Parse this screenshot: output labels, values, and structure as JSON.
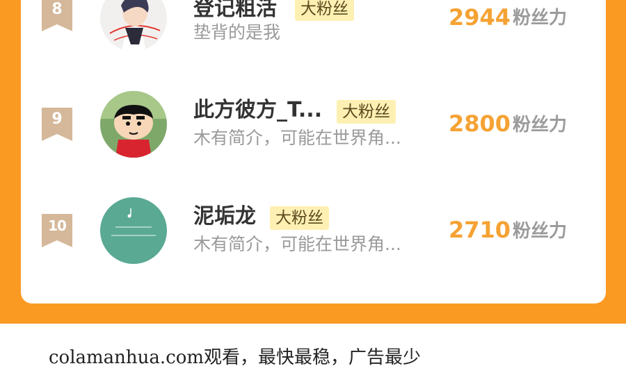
{
  "leaderboard": {
    "rows": [
      {
        "rank": "8",
        "name": "登记粗活",
        "badge": "大粉丝",
        "bio": "垫背的是我",
        "score": "2944",
        "score_label": "粉丝力"
      },
      {
        "rank": "9",
        "name": "此方彼方_T...",
        "badge": "大粉丝",
        "bio": "木有简介，可能在世界角...",
        "score": "2800",
        "score_label": "粉丝力"
      },
      {
        "rank": "10",
        "name": "泥垢龙",
        "badge": "大粉丝",
        "bio": "木有简介，可能在世界角...",
        "score": "2710",
        "score_label": "粉丝力"
      }
    ]
  },
  "footer": {
    "text": "colamanhua.com观看，最快最稳，广告最少"
  },
  "colors": {
    "accent_orange": "#fb9a23",
    "score_orange": "#f5a233",
    "badge_bg": "#fdf0b2",
    "rank_badge": "#d5b89a"
  }
}
